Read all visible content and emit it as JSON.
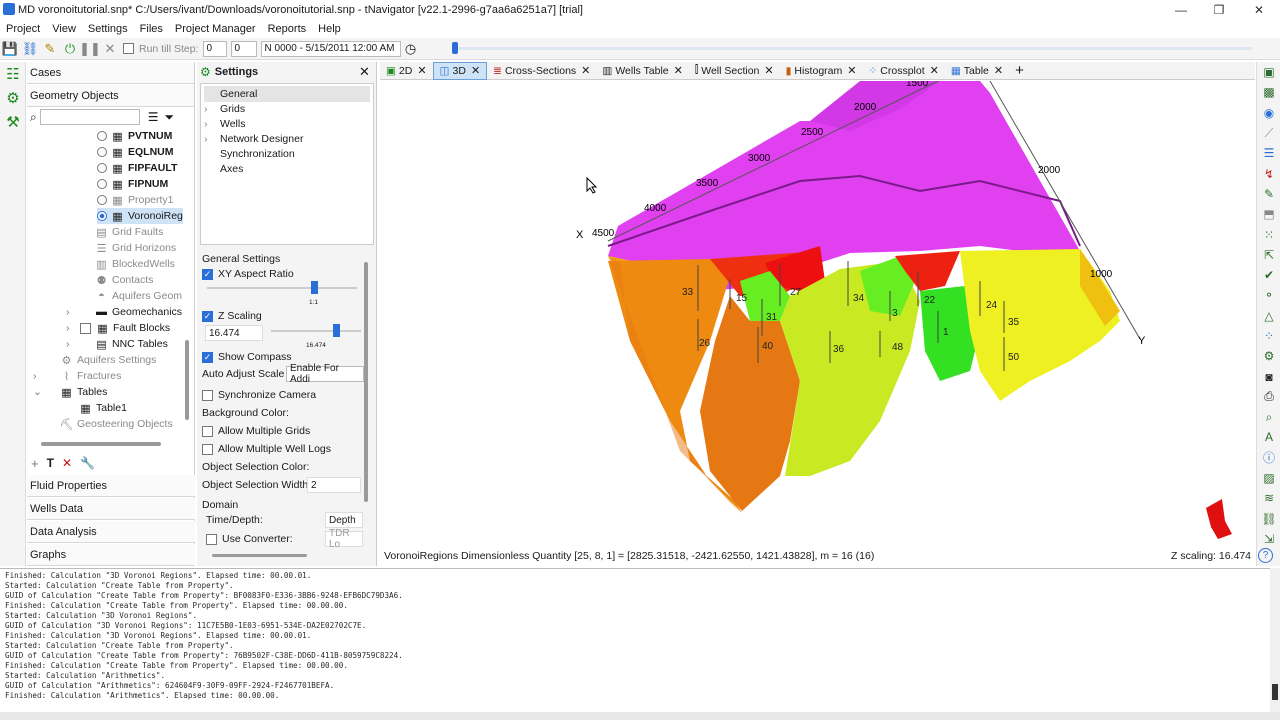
{
  "window": {
    "title": "MD voronoitutorial.snp* C:/Users/ivant/Downloads/voronoitutorial.snp - tNavigator [v22.1-2996-g7aa6a6251a7] [trial]",
    "minimize": "—",
    "maximize": "❐",
    "close": "✕"
  },
  "menu": [
    "Project",
    "View",
    "Settings",
    "Files",
    "Project Manager",
    "Reports",
    "Help"
  ],
  "toolbar": {
    "run_till_step_label": "Run till Step:",
    "run_till_step_value": "0",
    "step_value": "0",
    "date_value": "N 0000 - 5/15/2011 12:00 AM"
  },
  "cases_panel": {
    "header": "Cases",
    "geometry_objects": "Geometry Objects",
    "tree": [
      {
        "label": "PVTNUM"
      },
      {
        "label": "EQLNUM"
      },
      {
        "label": "FIPFAULT"
      },
      {
        "label": "FIPNUM"
      },
      {
        "label": "Property1"
      },
      {
        "label": "VoronoiReg"
      },
      {
        "label": "Grid Faults"
      },
      {
        "label": "Grid Horizons"
      },
      {
        "label": "BlockedWells"
      },
      {
        "label": "Contacts"
      },
      {
        "label": "Aquifers Geom"
      },
      {
        "label": "Geomechanics"
      },
      {
        "label": "Fault Blocks"
      },
      {
        "label": "NNC Tables"
      },
      {
        "label": "Aquifers Settings"
      },
      {
        "label": "Fractures"
      },
      {
        "label": "Tables"
      },
      {
        "label": "Table1"
      },
      {
        "label": "Geosteering Objects"
      }
    ],
    "sections": [
      "Fluid Properties",
      "Wells Data",
      "Data Analysis",
      "Graphs"
    ]
  },
  "settings_panel": {
    "header": "Settings",
    "tree": [
      "General",
      "Grids",
      "Wells",
      "Network Designer",
      "Synchronization",
      "Axes"
    ],
    "general_settings_label": "General Settings",
    "xy_aspect_ratio": "XY Aspect Ratio",
    "xy_slider_label": "1:1",
    "z_scaling": "Z Scaling",
    "z_scaling_value": "16.474",
    "z_slider_label": "16.474",
    "show_compass": "Show Compass",
    "auto_adjust_scale": "Auto Adjust Scale",
    "auto_adjust_value": "Enable For Addi",
    "synchronize_camera": "Synchronize Camera",
    "background_color": "Background Color:",
    "allow_multiple_grids": "Allow Multiple Grids",
    "allow_multiple_well_logs": "Allow Multiple Well Logs",
    "object_selection_color": "Object Selection Color:",
    "object_selection_width": "Object Selection Width:",
    "object_selection_width_value": "2",
    "domain": "Domain",
    "time_depth": "Time/Depth:",
    "time_depth_value": "Depth",
    "use_converter": "Use Converter:",
    "use_converter_value": "TDR Lo"
  },
  "tabs": [
    {
      "label": "2D"
    },
    {
      "label": "3D"
    },
    {
      "label": "Cross-Sections"
    },
    {
      "label": "Wells Table"
    },
    {
      "label": "Well Section"
    },
    {
      "label": "Histogram"
    },
    {
      "label": "Crossplot"
    },
    {
      "label": "Table"
    }
  ],
  "viewport": {
    "axis_x_label": "X",
    "axis_y_label": "Y",
    "x_ticks": [
      "4500",
      "4000",
      "3500",
      "3000",
      "2500",
      "2000",
      "1500"
    ],
    "y_ticks": [
      "2000",
      "1000"
    ],
    "region_labels": [
      "33",
      "15",
      "27",
      "31",
      "34",
      "3",
      "22",
      "1",
      "24",
      "35",
      "26",
      "40",
      "36",
      "48",
      "50"
    ]
  },
  "status": {
    "left": "VoronoiRegions Dimensionless Quantity [25, 8, 1] = [2825.31518, -2421.62550, 1421.43828], m = 16 (16)",
    "right": "Z scaling: 16.474"
  },
  "log": [
    "Finished: Calculation \"3D Voronoi Regions\". Elapsed time: 00.00.01.",
    "Started: Calculation \"Create Table from Property\".",
    "GUID of Calculation \"Create Table from Property\": BF0083F0-E336-3BB6-9248-EFB6DC79D3A6.",
    "Finished: Calculation \"Create Table from Property\". Elapsed time: 00.00.00.",
    "Started: Calculation \"3D Voronoi Regions\".",
    "GUID of Calculation \"3D Voronoi Regions\": 11C7E5B0-1E03-6951-534E-DA2E02702C7E.",
    "Finished: Calculation \"3D Voronoi Regions\". Elapsed time: 00.00.01.",
    "Started: Calculation \"Create Table from Property\".",
    "GUID of Calculation \"Create Table from Property\": 76B9502F-C38E-DD6D-411B-8059759C8224.",
    "Finished: Calculation \"Create Table from Property\". Elapsed time: 00.00.00.",
    "Started: Calculation \"Arithmetics\".",
    "GUID of Calculation \"Arithmetics\": 624604F9-30F9-09FF-2924-F2467701BEFA.",
    "Finished: Calculation \"Arithmetics\". Elapsed time: 00.00.00."
  ],
  "colors": {
    "accent": "#2a6fd6",
    "magenta": "#e040f0",
    "red": "#ee1a10",
    "orange": "#ee8a10",
    "green": "#66ee22",
    "yellow": "#eef022"
  }
}
